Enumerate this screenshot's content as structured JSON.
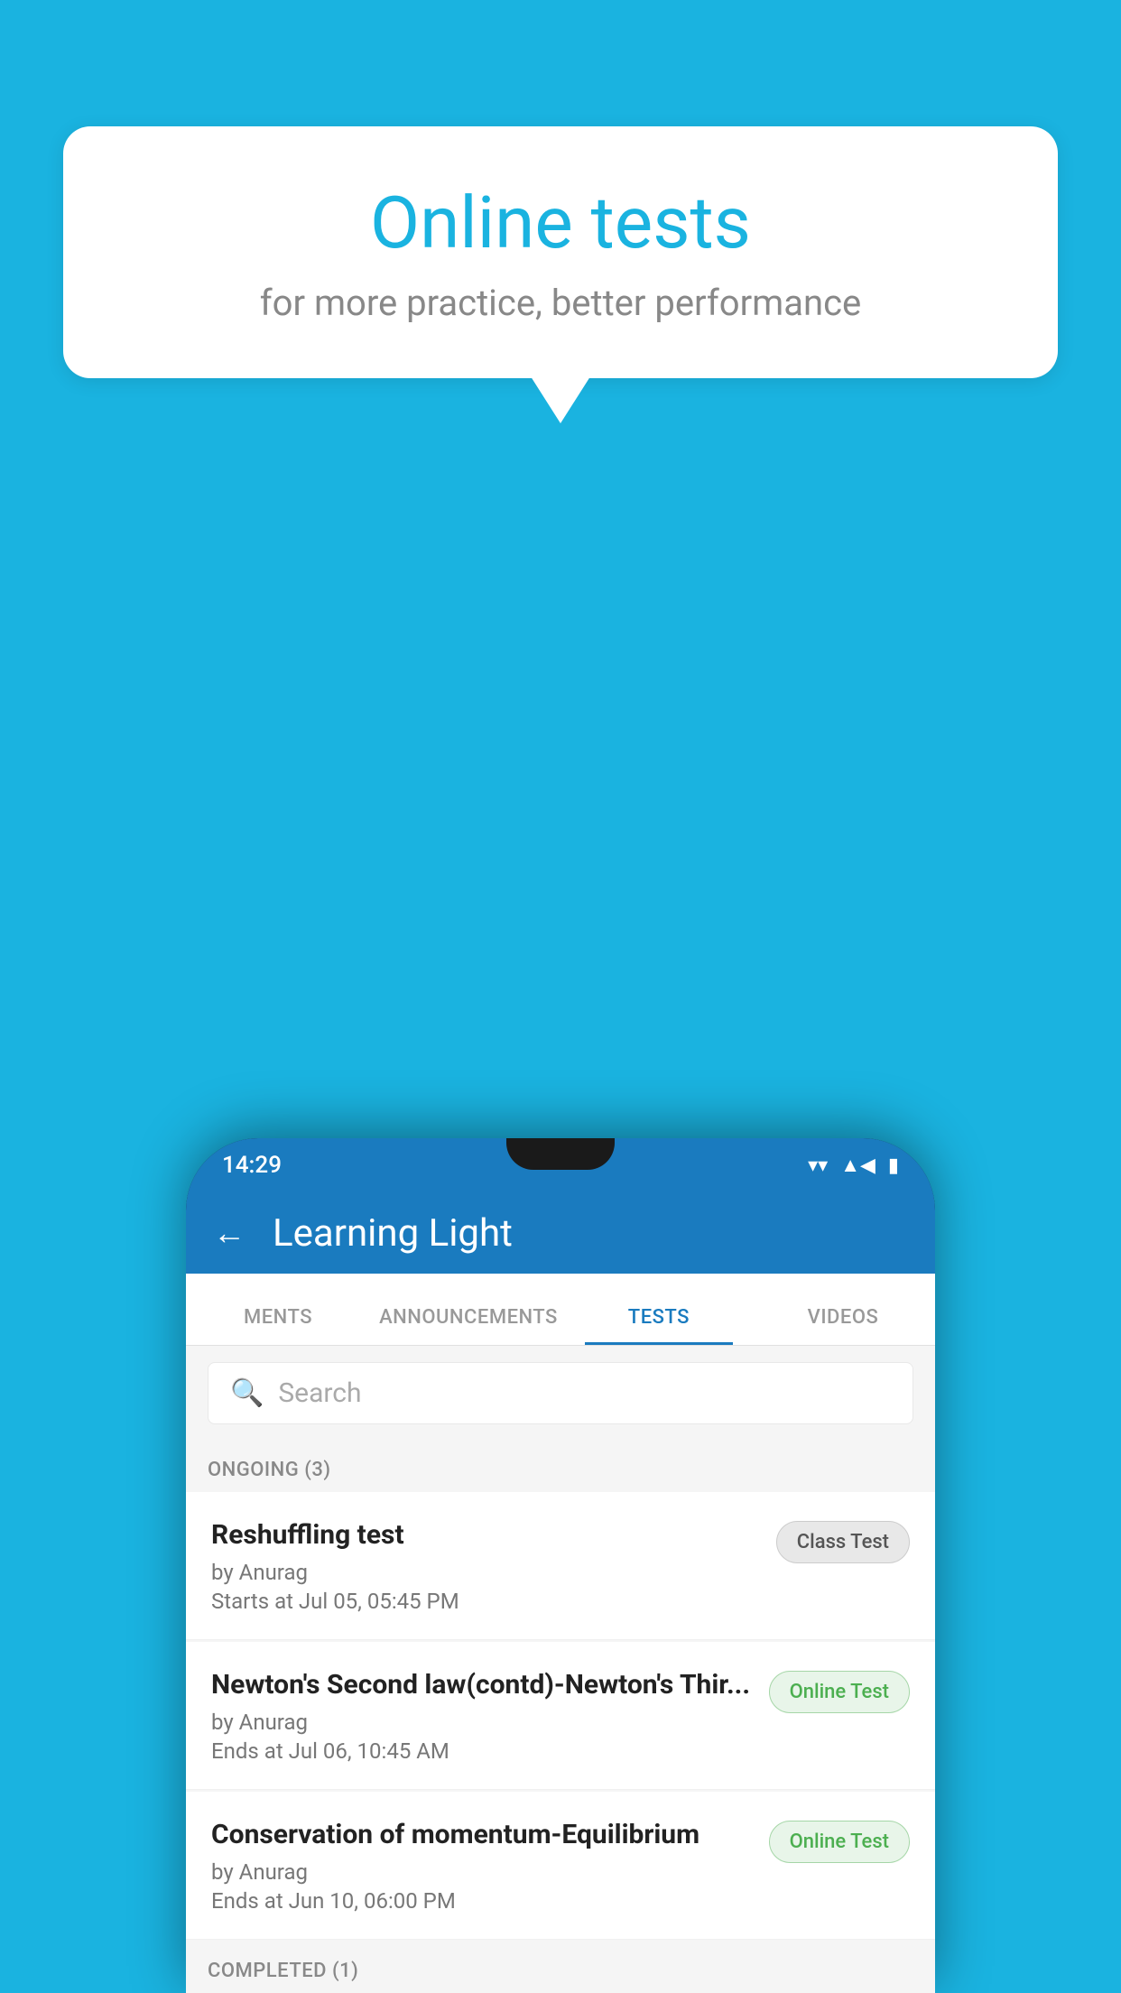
{
  "background_color": "#1ab3e0",
  "speech_bubble": {
    "title": "Online tests",
    "subtitle": "for more practice, better performance"
  },
  "phone": {
    "status_bar": {
      "time": "14:29",
      "wifi": "▾",
      "signal": "▲",
      "battery": "▮"
    },
    "app_bar": {
      "back_label": "←",
      "title": "Learning Light"
    },
    "tabs": [
      {
        "label": "MENTS",
        "active": false
      },
      {
        "label": "ANNOUNCEMENTS",
        "active": false
      },
      {
        "label": "TESTS",
        "active": true
      },
      {
        "label": "VIDEOS",
        "active": false
      }
    ],
    "search": {
      "placeholder": "Search"
    },
    "ongoing_section": {
      "header": "ONGOING (3)",
      "items": [
        {
          "name": "Reshuffling test",
          "author": "by Anurag",
          "date": "Starts at  Jul 05, 05:45 PM",
          "badge": "Class Test",
          "badge_type": "class"
        },
        {
          "name": "Newton's Second law(contd)-Newton's Thir...",
          "author": "by Anurag",
          "date": "Ends at  Jul 06, 10:45 AM",
          "badge": "Online Test",
          "badge_type": "online"
        },
        {
          "name": "Conservation of momentum-Equilibrium",
          "author": "by Anurag",
          "date": "Ends at  Jun 10, 06:00 PM",
          "badge": "Online Test",
          "badge_type": "online"
        }
      ]
    },
    "completed_section": {
      "header": "COMPLETED (1)"
    }
  }
}
